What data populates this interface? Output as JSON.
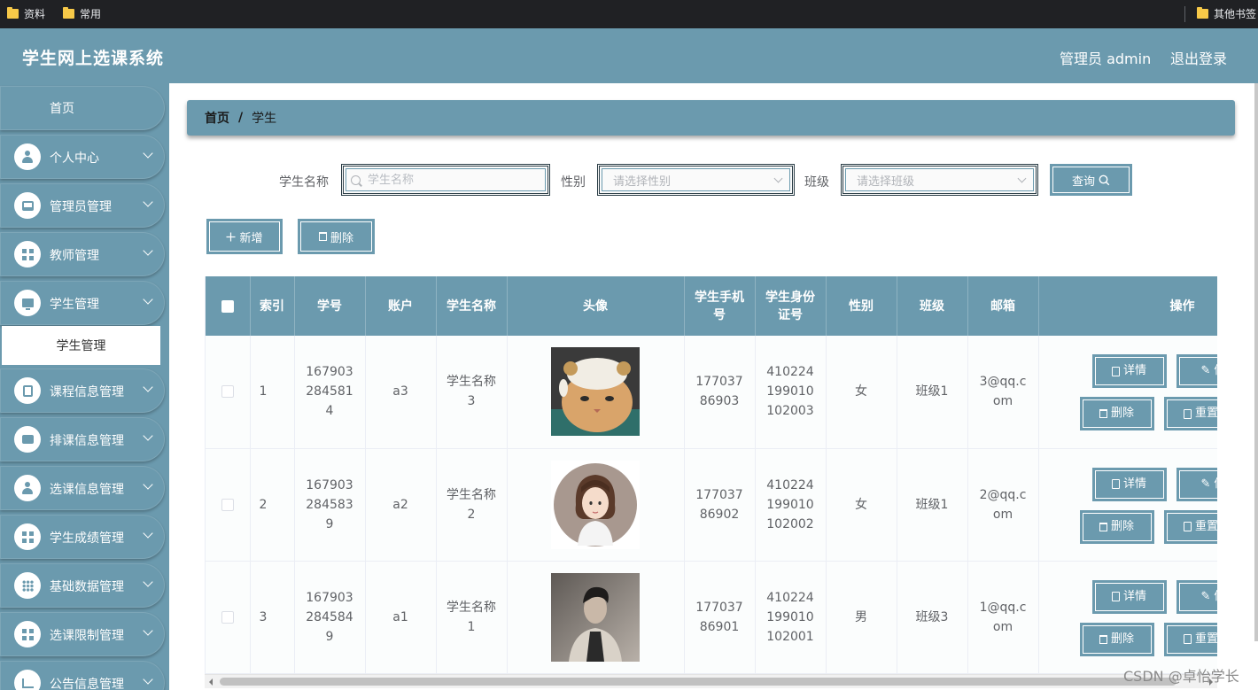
{
  "bookmarks": {
    "items": [
      "资料",
      "常用"
    ],
    "other": "其他书签"
  },
  "header": {
    "title": "学生网上选课系统",
    "admin": "管理员 admin",
    "logout": "退出登录"
  },
  "sidebar": {
    "home": "首页",
    "items": [
      {
        "label": "个人中心",
        "icon": "person-icon"
      },
      {
        "label": "管理员管理",
        "icon": "box-icon"
      },
      {
        "label": "教师管理",
        "icon": "grid-icon"
      },
      {
        "label": "学生管理",
        "icon": "monitor-icon"
      },
      {
        "label": "课程信息管理",
        "icon": "clipboard-icon"
      },
      {
        "label": "排课信息管理",
        "icon": "wallet-icon"
      },
      {
        "label": "选课信息管理",
        "icon": "person-icon"
      },
      {
        "label": "学生成绩管理",
        "icon": "grid-icon"
      },
      {
        "label": "基础数据管理",
        "icon": "grid9-icon"
      },
      {
        "label": "选课限制管理",
        "icon": "grid-icon"
      },
      {
        "label": "公告信息管理",
        "icon": "chart-icon"
      }
    ],
    "submenu": "学生管理"
  },
  "breadcrumb": {
    "home": "首页",
    "sep": "/",
    "current": "学生"
  },
  "filters": {
    "name_label": "学生名称",
    "name_placeholder": "学生名称",
    "gender_label": "性别",
    "gender_placeholder": "请选择性别",
    "class_label": "班级",
    "class_placeholder": "请选择班级",
    "search_button": "查询"
  },
  "actions": {
    "add": "新增",
    "delete": "删除"
  },
  "table": {
    "columns": [
      "索引",
      "学号",
      "账户",
      "学生名称",
      "头像",
      "学生手机号",
      "学生身份证号",
      "性别",
      "班级",
      "邮箱",
      "操作"
    ],
    "rows": [
      {
        "index": "1",
        "student_no": "1679032845814",
        "account": "a3",
        "name": "学生名称3",
        "avatar": "cat",
        "phone": "17703786903",
        "id_card": "410224199010102003",
        "gender": "女",
        "class": "班级1",
        "email": "3@qq.com"
      },
      {
        "index": "2",
        "student_no": "1679032845839",
        "account": "a2",
        "name": "学生名称2",
        "avatar": "girl",
        "phone": "17703786902",
        "id_card": "410224199010102002",
        "gender": "女",
        "class": "班级1",
        "email": "2@qq.com"
      },
      {
        "index": "3",
        "student_no": "1679032845849",
        "account": "a1",
        "name": "学生名称1",
        "avatar": "man",
        "phone": "17703786901",
        "id_card": "410224199010102001",
        "gender": "男",
        "class": "班级3",
        "email": "1@qq.com"
      }
    ],
    "ops": {
      "detail": "详情",
      "edit": "修",
      "delete": "删除",
      "reset": "重置"
    }
  },
  "watermark": "CSDN @卓怡学长",
  "colors": {
    "primary": "#6b9aae",
    "sidebar": "#6b9aae",
    "bookmark_bar": "#202124"
  }
}
